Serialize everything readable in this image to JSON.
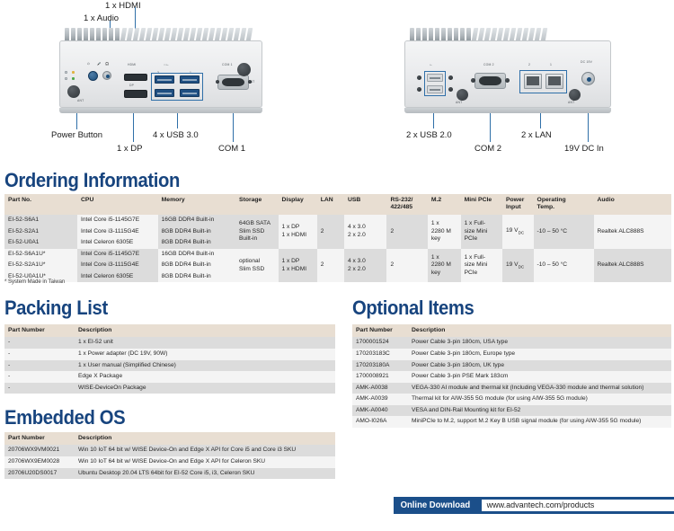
{
  "product_images": {
    "front_panel": {
      "callouts": [
        {
          "label": "1 x HDMI"
        },
        {
          "label": "1 x Audio"
        },
        {
          "label": "Power Button"
        },
        {
          "label": "1 x DP"
        },
        {
          "label": "4 x USB 3.0"
        },
        {
          "label": "COM 1"
        }
      ],
      "port_micro_labels": [
        "HDMI",
        "DP",
        "COM 1",
        "ANT",
        "1",
        "3",
        "2",
        "4"
      ]
    },
    "rear_panel": {
      "callouts": [
        {
          "label": "2 x USB 2.0"
        },
        {
          "label": "COM 2"
        },
        {
          "label": "2 x LAN"
        },
        {
          "label": "19V DC In"
        }
      ],
      "port_micro_labels": [
        "COM 2",
        "ANT",
        "DC 19V",
        "2",
        "1"
      ]
    }
  },
  "sections": {
    "ordering": {
      "title": "Ordering Information"
    },
    "packing": {
      "title": "Packing List"
    },
    "optional": {
      "title": "Optional Items"
    },
    "embedded_os": {
      "title": "Embedded OS"
    }
  },
  "ordering_table": {
    "headers": [
      "Part No.",
      "CPU",
      "Memory",
      "Storage",
      "Display",
      "LAN",
      "USB",
      "RS-232/\n422/485",
      "M.2",
      "Mini PCIe",
      "Power\nInput",
      "Operating\nTemp.",
      "Audio"
    ],
    "headers_flat": {
      "part_no": "Part No.",
      "cpu": "CPU",
      "memory": "Memory",
      "storage": "Storage",
      "display": "Display",
      "lan": "LAN",
      "usb": "USB",
      "rs232": "RS-232/ 422/485",
      "rs232_line1": "RS-232/",
      "rs232_line2": "422/485",
      "m2": "M.2",
      "mini_pcie": "Mini PCIe",
      "power_line1": "Power",
      "power_line2": "Input",
      "temp_line1": "Operating",
      "temp_line2": "Temp.",
      "audio": "Audio"
    },
    "group1": {
      "rows": [
        {
          "part_no": "EI-52-S6A1",
          "cpu": "Intel Core i5-1145G7E",
          "memory": "16GB DDR4 Built-in"
        },
        {
          "part_no": "EI-52-S2A1",
          "cpu": "Intel Core i3-1115G4E",
          "memory": "8GB DDR4 Built-in"
        },
        {
          "part_no": "EI-52-U0A1",
          "cpu": "Intel Celeron 6305E",
          "memory": "8GB DDR4 Built-in"
        }
      ],
      "storage_line1": "64GB SATA",
      "storage_line2": "Slim SSD",
      "storage_line3": "Built-in",
      "display_line1": "1 x DP",
      "display_line2": "1 x HDMI",
      "lan": "2",
      "usb_line1": "4 x 3.0",
      "usb_line2": "2 x 2.0",
      "rs232": "2",
      "m2_line1": "1 x",
      "m2_line2": "2280 M",
      "m2_line3": "key",
      "mini_pcie_line1": "1 x Full-",
      "mini_pcie_line2": "size Mini",
      "mini_pcie_line3": "PCIe",
      "power_input": "19 V",
      "power_input_sub": "DC",
      "operating_temp": "-10 – 50 °C",
      "audio": "Realtek ALC888S"
    },
    "group2": {
      "rows": [
        {
          "part_no": "EI-52-S6A1U*",
          "cpu": "Intel Core i5-1145G7E",
          "memory": "16GB DDR4 Built-in"
        },
        {
          "part_no": "EI-52-S2A1U*",
          "cpu": "Intel Core i3-1115G4E",
          "memory": "8GB DDR4 Built-in"
        },
        {
          "part_no": "EI-52-U0A1U*",
          "cpu": "Intel Celeron 6305E",
          "memory": "8GB DDR4 Built-in"
        }
      ],
      "storage_line1": "optional",
      "storage_line2": "Slim SSD",
      "storage_line3": "",
      "display_line1": "1 x DP",
      "display_line2": "1 x HDMI",
      "lan": "2",
      "usb_line1": "4 x 3.0",
      "usb_line2": "2 x 2.0",
      "rs232": "2",
      "m2_line1": "1 x",
      "m2_line2": "2280 M",
      "m2_line3": "key",
      "mini_pcie_line1": "1 x Full-",
      "mini_pcie_line2": "size Mini",
      "mini_pcie_line3": "PCIe",
      "power_input": "19 V",
      "power_input_sub": "DC",
      "operating_temp": "-10 – 50 °C",
      "audio": "Realtek ALC888S"
    },
    "footnote": "* System Made in Taiwan"
  },
  "packing_table": {
    "headers": {
      "part_number": "Part Number",
      "description": "Description"
    },
    "rows": [
      {
        "part_number": "-",
        "description": "1 x EI-52 unit"
      },
      {
        "part_number": "-",
        "description": "1 x Power adapter (DC 19V, 90W)"
      },
      {
        "part_number": "-",
        "description": "1 x User manual (Simplified Chinese)"
      },
      {
        "part_number": "-",
        "description": "Edge X Package"
      },
      {
        "part_number": "-",
        "description": "WISE-DeviceOn Package"
      }
    ]
  },
  "optional_table": {
    "headers": {
      "part_number": "Part Number",
      "description": "Description"
    },
    "rows": [
      {
        "part_number": "1700001524",
        "description": "Power Cable 3-pin 180cm, USA type"
      },
      {
        "part_number": "170203183C",
        "description": "Power Cable 3-pin 180cm, Europe type"
      },
      {
        "part_number": "170203180A",
        "description": "Power Cable 3-pin 180cm, UK type"
      },
      {
        "part_number": "1700008921",
        "description": "Power Cable 3-pin PSE Mark 183cm"
      },
      {
        "part_number": "AMK-A0038",
        "description": "VEGA-330 AI module and thermal kit (Including VEGA-330 module and thermal solution)"
      },
      {
        "part_number": "AMK-A0039",
        "description": "Thermal kit for AIW-355 5G module (for using AIW-355 5G module)"
      },
      {
        "part_number": "AMK-A0040",
        "description": "VESA and DIN-Rail Mounting kit for EI-52"
      },
      {
        "part_number": "AMO-I026A",
        "description": "MiniPCIe to M.2, support M.2 Key B USB signal module (for using AIW-355 5G module)"
      }
    ]
  },
  "embedded_os_table": {
    "headers": {
      "part_number": "Part Number",
      "description": "Description"
    },
    "rows": [
      {
        "part_number": "20706WX9VM0021",
        "description": "Win 10 IoT 64 bit w/ WISE Device-On and Edge X API for Core i5 and Core i3 SKU"
      },
      {
        "part_number": "20706WX9EM0028",
        "description": "Win 10 IoT 64 bit w/ WISE Device-On and Edge X API for Celeron SKU"
      },
      {
        "part_number": "20706U20DS0017",
        "description": "Ubuntu Desktop 20.04 LTS 64bit for EI-52 Core i5, i3, Celeron SKU"
      }
    ]
  },
  "footer": {
    "label": "Online Download",
    "url": "www.advantech.com/products"
  },
  "colors": {
    "heading_blue": "#17447e",
    "footer_blue": "#1b4f8a",
    "table_header_beige": "#e8ded2",
    "row_gray": "#dcdcdc",
    "row_light": "#f4f4f4",
    "callout_line": "#2f6fa8"
  }
}
